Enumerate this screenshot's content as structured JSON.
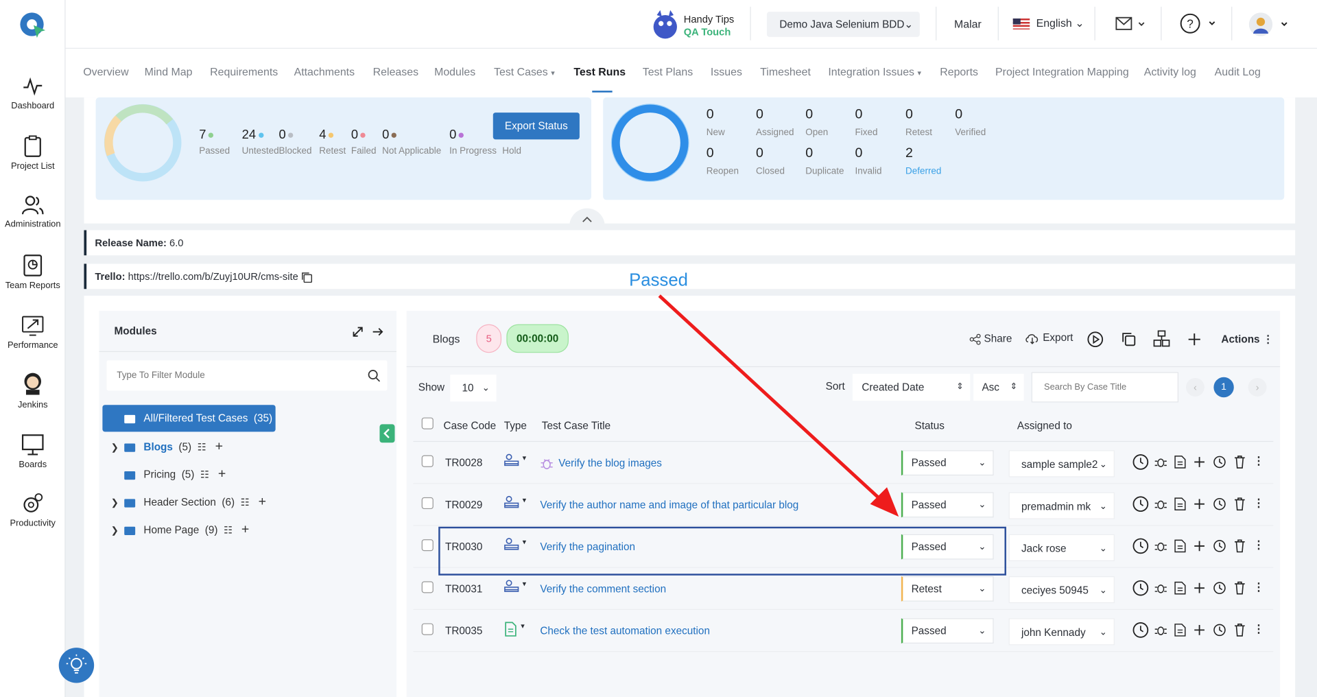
{
  "sidebar": {
    "items": [
      {
        "label": "Dashboard"
      },
      {
        "label": "Project List"
      },
      {
        "label": "Administration"
      },
      {
        "label": "Team Reports"
      },
      {
        "label": "Performance"
      },
      {
        "label": "Jenkins"
      },
      {
        "label": "Boards"
      },
      {
        "label": "Productivity"
      }
    ]
  },
  "topbar": {
    "handy_title": "Handy Tips",
    "handy_sub": "QA Touch",
    "project": "Demo Java Selenium BDD",
    "user": "Malar",
    "language": "English"
  },
  "nav": {
    "items": [
      "Overview",
      "Mind Map",
      "Requirements",
      "Attachments",
      "Releases",
      "Modules",
      "Test Cases",
      "Test Runs",
      "Test Plans",
      "Issues",
      "Timesheet",
      "Integration Issues",
      "Reports",
      "Project Integration Mapping",
      "Activity log",
      "Audit Log"
    ],
    "active": "Test Runs"
  },
  "run_stats": [
    {
      "value": "7",
      "label": "Passed",
      "color": "#8fd08f"
    },
    {
      "value": "24",
      "label": "Untested",
      "color": "#5fc3ee"
    },
    {
      "value": "0",
      "label": "Blocked",
      "color": "#b9bec5"
    },
    {
      "value": "4",
      "label": "Retest",
      "color": "#f5c76f"
    },
    {
      "value": "0",
      "label": "Failed",
      "color": "#ef8a95"
    },
    {
      "value": "0",
      "label": "Not Applicable",
      "color": "#8a6d55"
    },
    {
      "value": "0",
      "label": "In Progress",
      "color": "#b873d6"
    },
    {
      "value": "",
      "label": "Hold",
      "color": ""
    }
  ],
  "export_status": "Export Status",
  "issue_stats": [
    {
      "value": "0",
      "label": "New"
    },
    {
      "value": "0",
      "label": "Assigned"
    },
    {
      "value": "0",
      "label": "Open"
    },
    {
      "value": "0",
      "label": "Fixed"
    },
    {
      "value": "0",
      "label": "Retest"
    },
    {
      "value": "0",
      "label": "Verified"
    },
    {
      "value": "0",
      "label": "Reopen"
    },
    {
      "value": "0",
      "label": "Closed"
    },
    {
      "value": "0",
      "label": "Duplicate"
    },
    {
      "value": "0",
      "label": "Invalid"
    },
    {
      "value": "2",
      "label": "Deferred"
    }
  ],
  "release": {
    "label": "Release Name:",
    "value": "6.0"
  },
  "trello": {
    "label": "Trello:",
    "value": "https://trello.com/b/Zuyj10UR/cms-site"
  },
  "annotation": "Passed",
  "modules": {
    "title": "Modules",
    "filter_placeholder": "Type To Filter Module",
    "all_label": "All/Filtered Test Cases",
    "all_count": "(35)",
    "items": [
      {
        "name": "Blogs",
        "count": "(5)"
      },
      {
        "name": "Pricing",
        "count": "(5)"
      },
      {
        "name": "Header Section",
        "count": "(6)"
      },
      {
        "name": "Home Page",
        "count": "(9)"
      }
    ]
  },
  "grid": {
    "module": "Blogs",
    "count": "5",
    "timer": "00:00:00",
    "share": "Share",
    "export": "Export",
    "actions": "Actions",
    "show_label": "Show",
    "show_value": "10",
    "sort_label": "Sort",
    "sort_value": "Created Date",
    "order": "Asc",
    "search_placeholder": "Search By Case Title",
    "page": "1",
    "headers": {
      "code": "Case Code",
      "type": "Type",
      "title": "Test Case Title",
      "status": "Status",
      "assigned": "Assigned to"
    },
    "rows": [
      {
        "code": "TR0028",
        "title": "Verify the blog images",
        "status": "Passed",
        "assigned": "sample sample2"
      },
      {
        "code": "TR0029",
        "title": "Verify the author name and image of that particular blog",
        "status": "Passed",
        "assigned": "premadmin mk"
      },
      {
        "code": "TR0030",
        "title": "Verify the pagination",
        "status": "Passed",
        "assigned": "Jack rose"
      },
      {
        "code": "TR0031",
        "title": "Verify the comment section",
        "status": "Retest",
        "assigned": "ceciyes 50945"
      },
      {
        "code": "TR0035",
        "title": "Check the test automation execution",
        "status": "Passed",
        "assigned": "john Kennady"
      }
    ]
  }
}
